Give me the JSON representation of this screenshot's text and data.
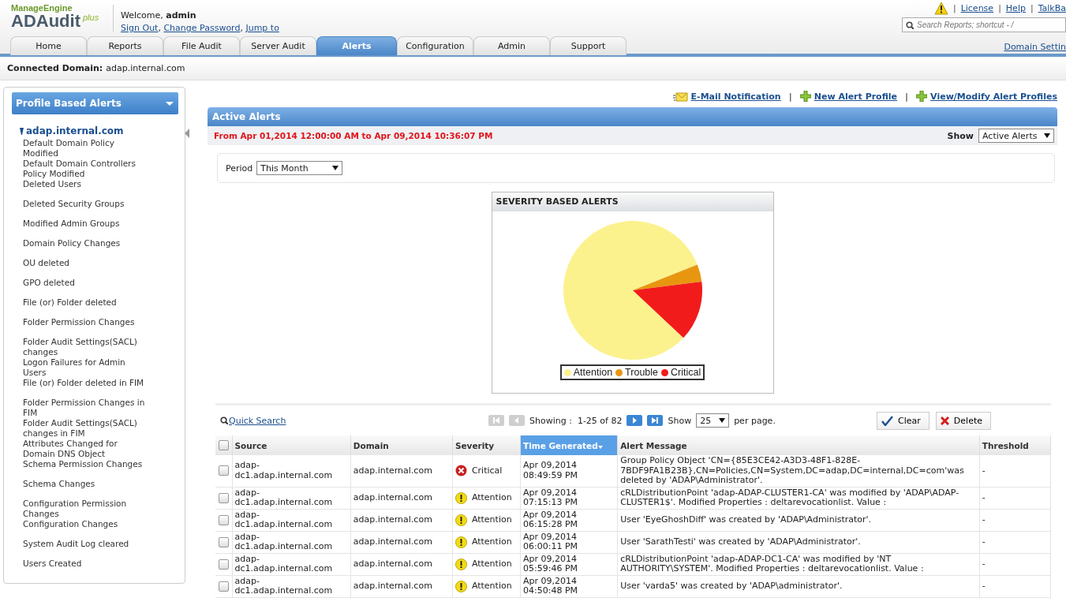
{
  "header": {
    "logo_brand": "ManageEngine",
    "logo_product": "ADAudit",
    "logo_suffix": "plus",
    "welcome": "Welcome, **admin**",
    "links": [
      "Sign Out",
      "Change Password",
      "Jump to"
    ],
    "link_separator": ",",
    "top_separator": "|",
    "top_links": [
      "License",
      "Help",
      "TalkBa"
    ],
    "search": {
      "placeholder": "Search Reports; shortcut - /"
    },
    "domain_settings": "Domain Settin"
  },
  "tabs": [
    {
      "label": "Home",
      "selected": false
    },
    {
      "label": "Reports",
      "selected": false
    },
    {
      "label": "File Audit",
      "selected": false
    },
    {
      "label": "Server Audit",
      "selected": false
    },
    {
      "label": "Alerts",
      "selected": true
    },
    {
      "label": "Configuration",
      "selected": false
    },
    {
      "label": "Admin",
      "selected": false
    },
    {
      "label": "Support",
      "selected": false
    }
  ],
  "connected_domain": {
    "label": "Connected Domain:",
    "value": "adap.internal.com"
  },
  "sidebar": {
    "title": "Profile Based Alerts",
    "domain": "adap.internal.com",
    "items": [
      "Default Domain Policy Modified",
      "Default Domain Controllers Policy Modified",
      "Deleted Users",
      "Deleted Security Groups",
      "Modified Admin Groups",
      "Domain Policy Changes",
      "OU deleted",
      "GPO deleted",
      "File (or) Folder deleted",
      "Folder Permission Changes",
      "Folder Audit Settings(SACL) changes",
      "Logon Failures for Admin Users",
      "File (or) Folder deleted in FIM",
      "Folder Permission Changes in FIM",
      "Folder Audit Settings(SACL) changes in FIM",
      "Attributes Changed for Domain DNS Object",
      "Schema Permission Changes",
      "Schema Changes",
      "Configuration Permission Changes",
      "Configuration Changes",
      "System Audit Log cleared",
      "Users Created"
    ]
  },
  "actions": [
    "E-Mail Notification",
    "New Alert Profile",
    "View/Modify Alert Profiles"
  ],
  "action_separator": "|",
  "panel": {
    "title": "Active Alerts",
    "range": "From Apr 01,2014 12:00:00 AM to Apr 09,2014 10:36:07 PM",
    "show_label": "Show",
    "show_value": "Active Alerts",
    "period_label": "Period",
    "period_value": "This Month"
  },
  "chart": {
    "title": "SEVERITY BASED ALERTS",
    "legend": [
      {
        "label": "Attention",
        "color": "#fbf28e"
      },
      {
        "label": "Trouble",
        "color": "#e8960f"
      },
      {
        "label": "Critical",
        "color": "#f21b1b"
      }
    ]
  },
  "pager": {
    "quick_search": "Quick Search",
    "showing": "Showing :  1-25 of 82",
    "show": "Show",
    "per_page_value": "25",
    "per_page": "per page.",
    "clear": "Clear",
    "delete": "Delete"
  },
  "table": {
    "select_all": {
      "checked": false
    },
    "columns": [
      "Source",
      "Domain",
      "Severity",
      "Time Generated",
      "Alert Message",
      "Threshold"
    ],
    "rows": [
      {
        "checked": false,
        "source": "adap-dc1.adap.internal.com",
        "domain": "adap.internal.com",
        "severity": "Critical",
        "kind": "critical",
        "time": "Apr 09,2014 08:49:59 PM",
        "message": "Group Policy Object 'CN={85E3CE42-A3D3-48F1-828E-7BDF9FA1B23B},CN=Policies,CN=System,DC=adap,DC=internal,DC=com'was deleted by 'ADAP\\Administrator'.",
        "threshold": "-"
      },
      {
        "checked": false,
        "source": "adap-dc1.adap.internal.com",
        "domain": "adap.internal.com",
        "severity": "Attention",
        "kind": "attention",
        "time": "Apr 09,2014 07:15:13 PM",
        "message": "cRLDistributionPoint 'adap-ADAP-CLUSTER1-CA' was modified by 'ADAP\\ADAP-CLUSTER1$'. Modified Properties : deltarevocationlist. Value :",
        "threshold": "-"
      },
      {
        "checked": false,
        "source": "adap-dc1.adap.internal.com",
        "domain": "adap.internal.com",
        "severity": "Attention",
        "kind": "attention",
        "time": "Apr 09,2014 06:15:28 PM",
        "message": "User 'EyeGhoshDiff' was created by 'ADAP\\Administrator'.",
        "threshold": "-"
      },
      {
        "checked": false,
        "source": "adap-dc1.adap.internal.com",
        "domain": "adap.internal.com",
        "severity": "Attention",
        "kind": "attention",
        "time": "Apr 09,2014 06:00:11 PM",
        "message": "User 'SarathTesti' was created by 'ADAP\\Administrator'.",
        "threshold": "-"
      },
      {
        "checked": false,
        "source": "adap-dc1.adap.internal.com",
        "domain": "adap.internal.com",
        "severity": "Attention",
        "kind": "attention",
        "time": "Apr 09,2014 05:59:46 PM",
        "message": "cRLDistributionPoint 'adap-ADAP-DC1-CA' was modified by 'NT AUTHORITY\\SYSTEM'. Modified Properties : deltarevocationlist. Value :",
        "threshold": "-"
      },
      {
        "checked": false,
        "source": "adap-dc1.adap.internal.com",
        "domain": "adap.internal.com",
        "severity": "Attention",
        "kind": "attention",
        "time": "Apr 09,2014 04:50:48 PM",
        "message": "User 'varda5' was created by 'ADAP\\administrator'.",
        "threshold": "-"
      }
    ]
  }
}
